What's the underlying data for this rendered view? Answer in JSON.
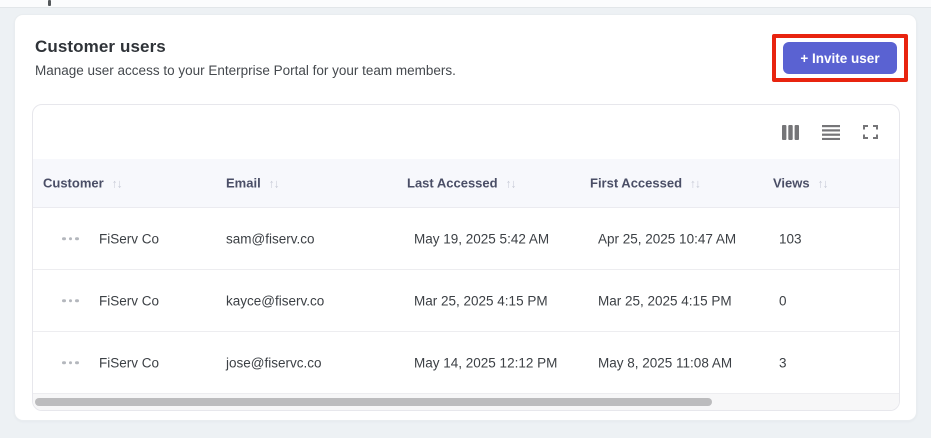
{
  "header": {
    "title": "Customer users",
    "subtitle": "Manage user access to your Enterprise Portal for your team members.",
    "invite_button_label": "+ Invite user"
  },
  "toolbar": {
    "icons": [
      "columns-icon",
      "density-icon",
      "fullscreen-icon"
    ]
  },
  "table": {
    "columns": [
      "Customer",
      "Email",
      "Last Accessed",
      "First Accessed",
      "Views"
    ],
    "sort_glyph": "↑↓",
    "rows": [
      {
        "customer": "FiServ Co",
        "email": "sam@fiserv.co",
        "last_accessed": "May 19, 2025 5:42 AM",
        "first_accessed": "Apr 25, 2025 10:47 AM",
        "views": "103"
      },
      {
        "customer": "FiServ Co",
        "email": "kayce@fiserv.co",
        "last_accessed": "Mar 25, 2025 4:15 PM",
        "first_accessed": "Mar 25, 2025 4:15 PM",
        "views": "0"
      },
      {
        "customer": "FiServ Co",
        "email": "jose@fiservc.co",
        "last_accessed": "May 14, 2025 12:12 PM",
        "first_accessed": "May 8, 2025 11:08 AM",
        "views": "3"
      }
    ]
  },
  "colors": {
    "accent": "#5a62d2",
    "annotation": "#e8240f",
    "header_row_bg": "#f7f8fc",
    "page_bg": "#edf1f4"
  }
}
